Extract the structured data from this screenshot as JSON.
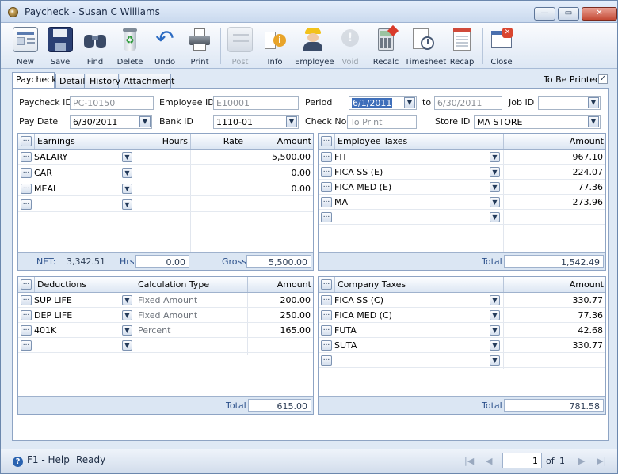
{
  "window": {
    "title": "Paycheck - Susan C Williams"
  },
  "toolbar": [
    {
      "id": "new",
      "label": "New",
      "icon": "new-icon",
      "enabled": true
    },
    {
      "id": "save",
      "label": "Save",
      "icon": "save-icon",
      "enabled": true
    },
    {
      "id": "find",
      "label": "Find",
      "icon": "binoculars-icon",
      "enabled": true
    },
    {
      "id": "delete",
      "label": "Delete",
      "icon": "recycle-bin-icon",
      "enabled": true
    },
    {
      "id": "undo",
      "label": "Undo",
      "icon": "undo-arrow-icon",
      "enabled": true
    },
    {
      "id": "print",
      "label": "Print",
      "icon": "printer-icon",
      "enabled": true
    },
    {
      "id": "post",
      "label": "Post",
      "icon": "post-icon",
      "enabled": false
    },
    {
      "id": "info",
      "label": "Info",
      "icon": "info-icon",
      "enabled": true
    },
    {
      "id": "employee",
      "label": "Employee",
      "icon": "employee-icon",
      "enabled": true
    },
    {
      "id": "void",
      "label": "Void",
      "icon": "void-icon",
      "enabled": false
    },
    {
      "id": "recalc",
      "label": "Recalc",
      "icon": "calculator-icon",
      "enabled": true
    },
    {
      "id": "timesheet",
      "label": "Timesheet",
      "icon": "timesheet-icon",
      "enabled": true
    },
    {
      "id": "recap",
      "label": "Recap",
      "icon": "recap-icon",
      "enabled": true
    },
    {
      "id": "close",
      "label": "Close",
      "icon": "close-window-icon",
      "enabled": true
    }
  ],
  "tabs": [
    "Paycheck",
    "Detail",
    "History",
    "Attachment"
  ],
  "to_be_printed": {
    "label": "To Be Printed",
    "checked": true,
    "mark": "✓"
  },
  "form": {
    "paycheck_id": {
      "label": "Paycheck ID",
      "value": "PC-10150"
    },
    "employee_id": {
      "label": "Employee ID",
      "value": "E10001"
    },
    "period": {
      "label": "Period",
      "from": "6/1/2011",
      "to_label": "to",
      "to": "6/30/2011"
    },
    "job_id": {
      "label": "Job ID",
      "value": ""
    },
    "pay_date": {
      "label": "Pay Date",
      "value": "6/30/2011"
    },
    "bank_id": {
      "label": "Bank ID",
      "value": "1110-01"
    },
    "check_no": {
      "label": "Check No",
      "placeholder": "To Print"
    },
    "store_id": {
      "label": "Store ID",
      "value": "MA STORE"
    }
  },
  "earnings": {
    "headers": {
      "name": "Earnings",
      "hours": "Hours",
      "rate": "Rate",
      "amount": "Amount"
    },
    "rows": [
      {
        "name": "SALARY",
        "hours": "",
        "rate": "",
        "amount": "5,500.00"
      },
      {
        "name": "CAR",
        "hours": "",
        "rate": "",
        "amount": "0.00"
      },
      {
        "name": "MEAL",
        "hours": "",
        "rate": "",
        "amount": "0.00"
      },
      {
        "name": "",
        "hours": "",
        "rate": "",
        "amount": ""
      }
    ],
    "footer": {
      "net_label": "NET:",
      "net": "3,342.51",
      "hrs_label": "Hrs",
      "hrs": "0.00",
      "gross_label": "Gross",
      "gross": "5,500.00"
    }
  },
  "employee_taxes": {
    "headers": {
      "name": "Employee Taxes",
      "amount": "Amount"
    },
    "rows": [
      {
        "name": "FIT",
        "amount": "967.10"
      },
      {
        "name": "FICA SS (E)",
        "amount": "224.07"
      },
      {
        "name": "FICA MED (E)",
        "amount": "77.36"
      },
      {
        "name": "MA",
        "amount": "273.96"
      },
      {
        "name": "",
        "amount": ""
      }
    ],
    "footer": {
      "total_label": "Total",
      "total": "1,542.49"
    }
  },
  "deductions": {
    "headers": {
      "name": "Deductions",
      "calc": "Calculation Type",
      "amount": "Amount"
    },
    "rows": [
      {
        "name": "SUP LIFE",
        "calc": "Fixed Amount",
        "amount": "200.00"
      },
      {
        "name": "DEP LIFE",
        "calc": "Fixed Amount",
        "amount": "250.00"
      },
      {
        "name": "401K",
        "calc": "Percent",
        "amount": "165.00"
      },
      {
        "name": "",
        "calc": "",
        "amount": ""
      }
    ],
    "footer": {
      "total_label": "Total",
      "total": "615.00"
    }
  },
  "company_taxes": {
    "headers": {
      "name": "Company Taxes",
      "amount": "Amount"
    },
    "rows": [
      {
        "name": "FICA SS (C)",
        "amount": "330.77"
      },
      {
        "name": "FICA MED (C)",
        "amount": "77.36"
      },
      {
        "name": "FUTA",
        "amount": "42.68"
      },
      {
        "name": "SUTA",
        "amount": "330.77"
      },
      {
        "name": "",
        "amount": ""
      }
    ],
    "footer": {
      "total_label": "Total",
      "total": "781.58"
    }
  },
  "statusbar": {
    "help": "F1 - Help",
    "status": "Ready",
    "page": "1",
    "of_label": "of",
    "pages": "1"
  },
  "colors": {
    "accent": "#3f6fba",
    "panel_border": "#8ea4c4",
    "footer_bg": "#dbe6f3"
  }
}
